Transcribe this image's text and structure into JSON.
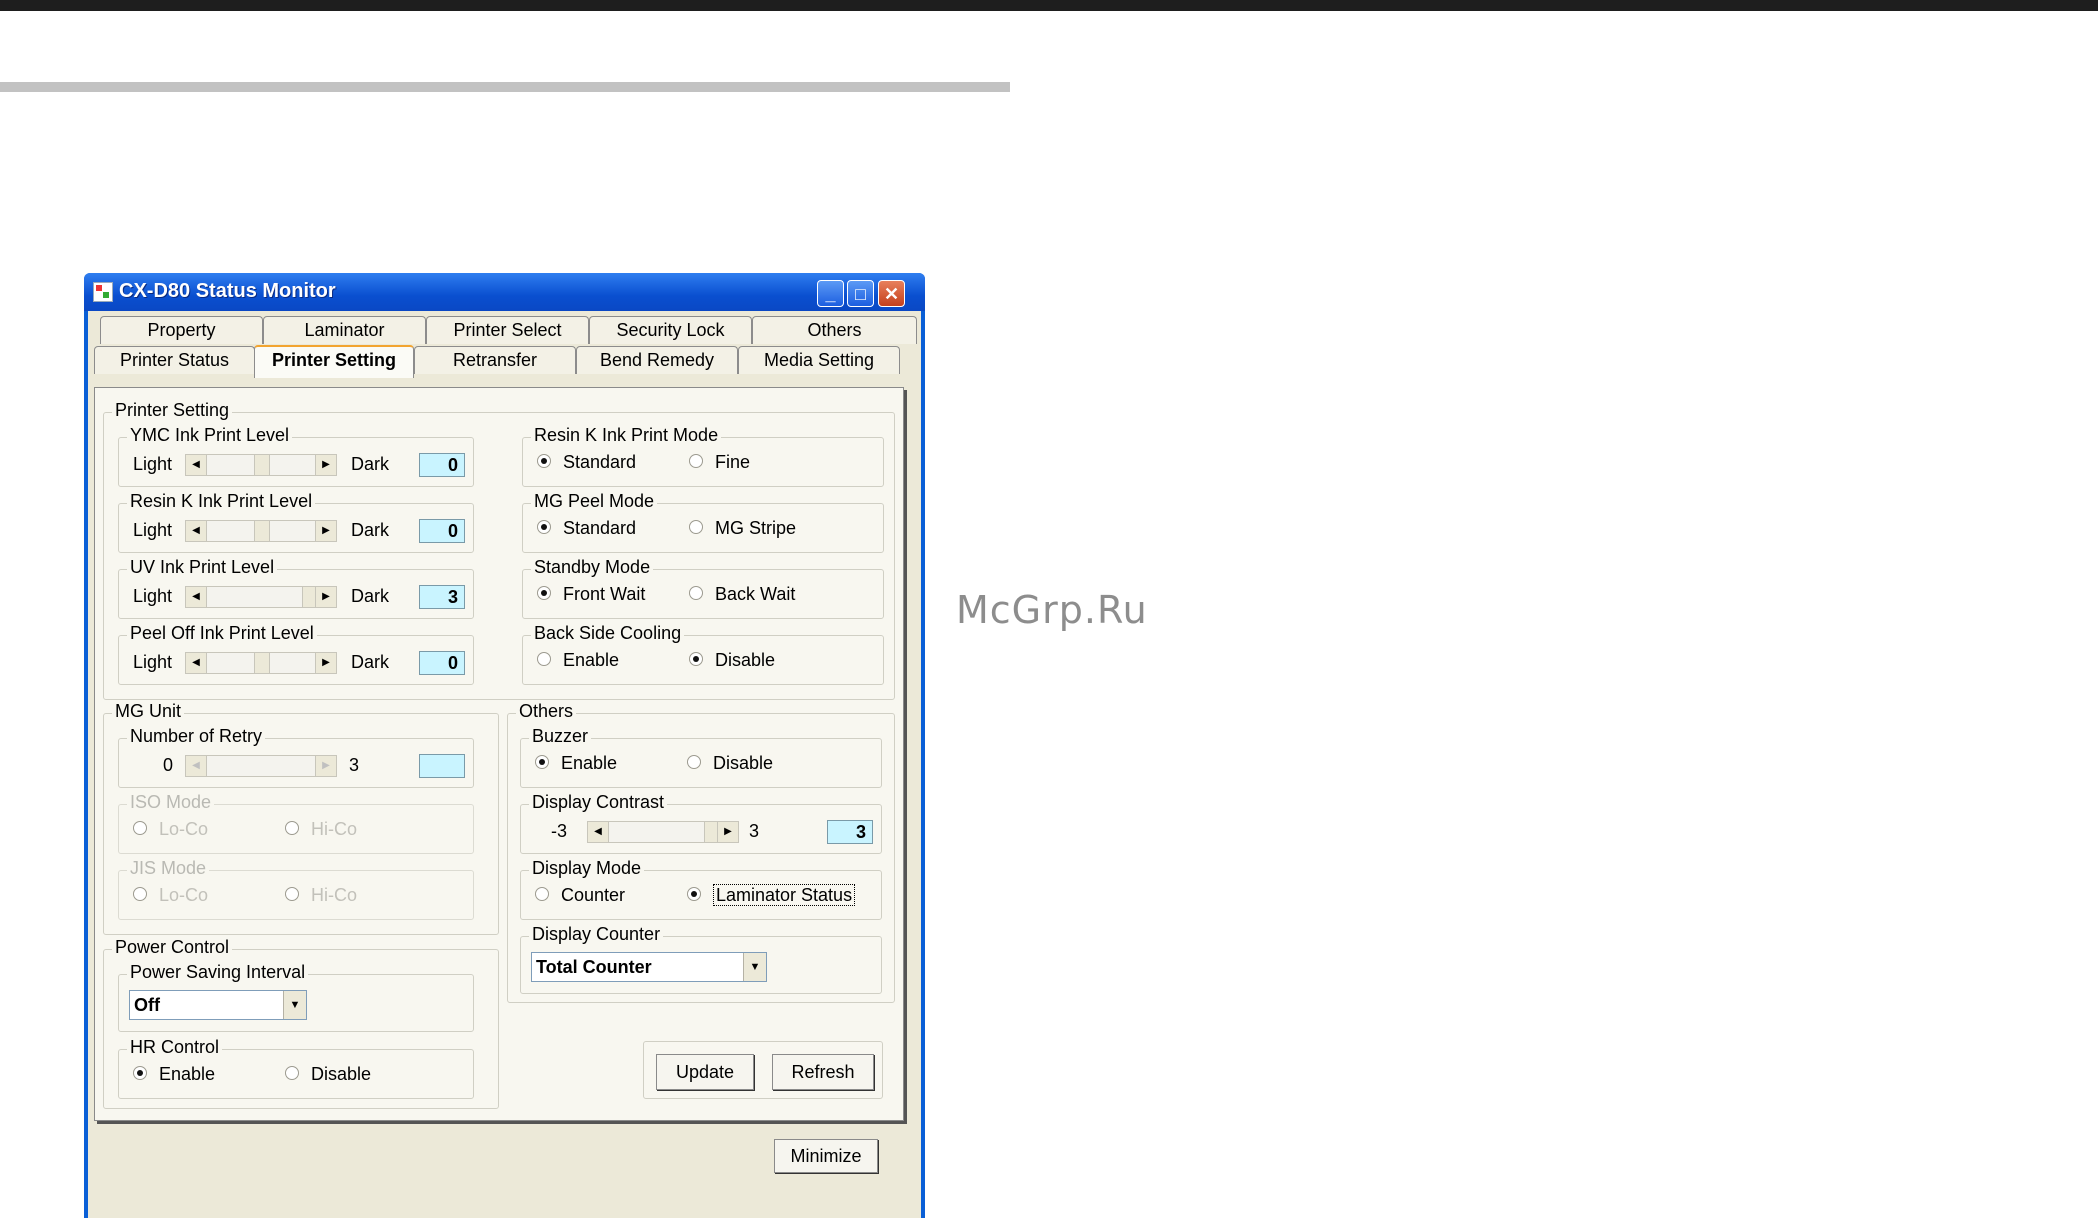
{
  "watermark": "McGrp.Ru",
  "window": {
    "title": "CX-D80 Status Monitor"
  },
  "tabs": {
    "row1": [
      "Property",
      "Laminator",
      "Printer Select",
      "Security Lock",
      "Others"
    ],
    "row2": [
      "Printer Status",
      "Printer Setting",
      "Retransfer",
      "Bend Remedy",
      "Media Setting"
    ],
    "active": "Printer Setting"
  },
  "printer_setting": {
    "label": "Printer Setting",
    "ymc": {
      "label": "YMC Ink Print Level",
      "light": "Light",
      "dark": "Dark",
      "value": "0"
    },
    "resin": {
      "label": "Resin K Ink Print Level",
      "light": "Light",
      "dark": "Dark",
      "value": "0"
    },
    "uv": {
      "label": "UV Ink Print Level",
      "light": "Light",
      "dark": "Dark",
      "value": "3"
    },
    "peel": {
      "label": "Peel Off Ink Print Level",
      "light": "Light",
      "dark": "Dark",
      "value": "0"
    },
    "resin_mode": {
      "label": "Resin K Ink Print Mode",
      "opt1": "Standard",
      "opt2": "Fine",
      "selected": "Standard"
    },
    "mg_peel": {
      "label": "MG Peel Mode",
      "opt1": "Standard",
      "opt2": "MG Stripe",
      "selected": "Standard"
    },
    "standby": {
      "label": "Standby Mode",
      "opt1": "Front Wait",
      "opt2": "Back Wait",
      "selected": "Front Wait"
    },
    "cooling": {
      "label": "Back Side Cooling",
      "opt1": "Enable",
      "opt2": "Disable",
      "selected": "Disable"
    }
  },
  "mg_unit": {
    "label": "MG Unit",
    "retry": {
      "label": "Number of Retry",
      "min": "0",
      "max": "3",
      "value": ""
    },
    "iso": {
      "label": "ISO Mode",
      "opt1": "Lo-Co",
      "opt2": "Hi-Co"
    },
    "jis": {
      "label": "JIS Mode",
      "opt1": "Lo-Co",
      "opt2": "Hi-Co"
    }
  },
  "power": {
    "label": "Power Control",
    "interval": {
      "label": "Power Saving Interval",
      "value": "Off"
    },
    "hr": {
      "label": "HR Control",
      "opt1": "Enable",
      "opt2": "Disable",
      "selected": "Enable"
    }
  },
  "others": {
    "label": "Others",
    "buzzer": {
      "label": "Buzzer",
      "opt1": "Enable",
      "opt2": "Disable",
      "selected": "Enable"
    },
    "contrast": {
      "label": "Display Contrast",
      "min": "-3",
      "max": "3",
      "value": "3"
    },
    "display_mode": {
      "label": "Display Mode",
      "opt1": "Counter",
      "opt2": "Laminator Status",
      "selected": "Laminator Status"
    },
    "display_counter": {
      "label": "Display Counter",
      "value": "Total Counter"
    }
  },
  "buttons": {
    "update": "Update",
    "refresh": "Refresh",
    "minimize": "Minimize"
  }
}
